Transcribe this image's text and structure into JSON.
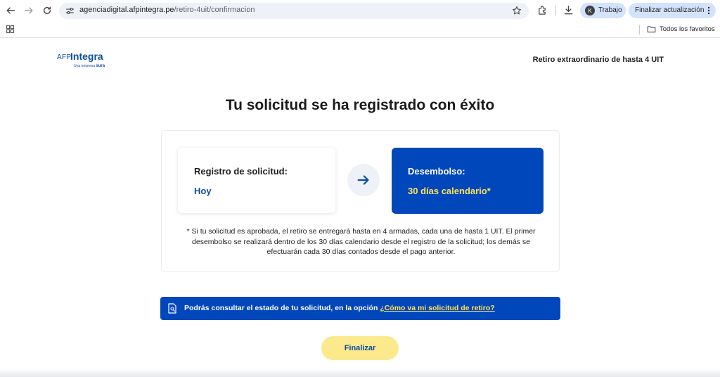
{
  "browser": {
    "url_domain": "agenciadigital.afpintegra.pe",
    "url_path": "/retiro-4uit/confirmacion",
    "profile_initial": "K",
    "profile_name": "Trabajo",
    "update_label": "Finalizar actualización",
    "bookmarks_label": "Todos los favoritos"
  },
  "header": {
    "logo_afp": "AFP",
    "logo_integra": "Integra",
    "logo_tagline": "Una empresa",
    "logo_sura": "sura",
    "title": "Retiro extraordinario de hasta 4 UIT"
  },
  "main": {
    "title": "Tu solicitud se ha registrado con éxito",
    "registro_label": "Registro de solicitud:",
    "registro_value": "Hoy",
    "desembolso_label": "Desembolso:",
    "desembolso_value": "30 días calendario*",
    "note": "* Si tu solicitud es aprobada, el retiro se entregará hasta en 4 armadas, cada una de hasta 1 UIT. El primer desembolso se realizará dentro de los 30 días calendario desde el registro de la solicitud; los demás se efectuarán cada 30 días contados desde el pago anterior."
  },
  "info": {
    "text": "Podrás consultar el estado de tu solicitud, en la opción ",
    "link": "¿Cómo va mi solicitud de retiro?"
  },
  "actions": {
    "finish_label": "Finalizar"
  },
  "colors": {
    "brand_blue": "#0047bb",
    "accent_yellow": "#ffe259",
    "button_yellow": "#fbe98b"
  }
}
